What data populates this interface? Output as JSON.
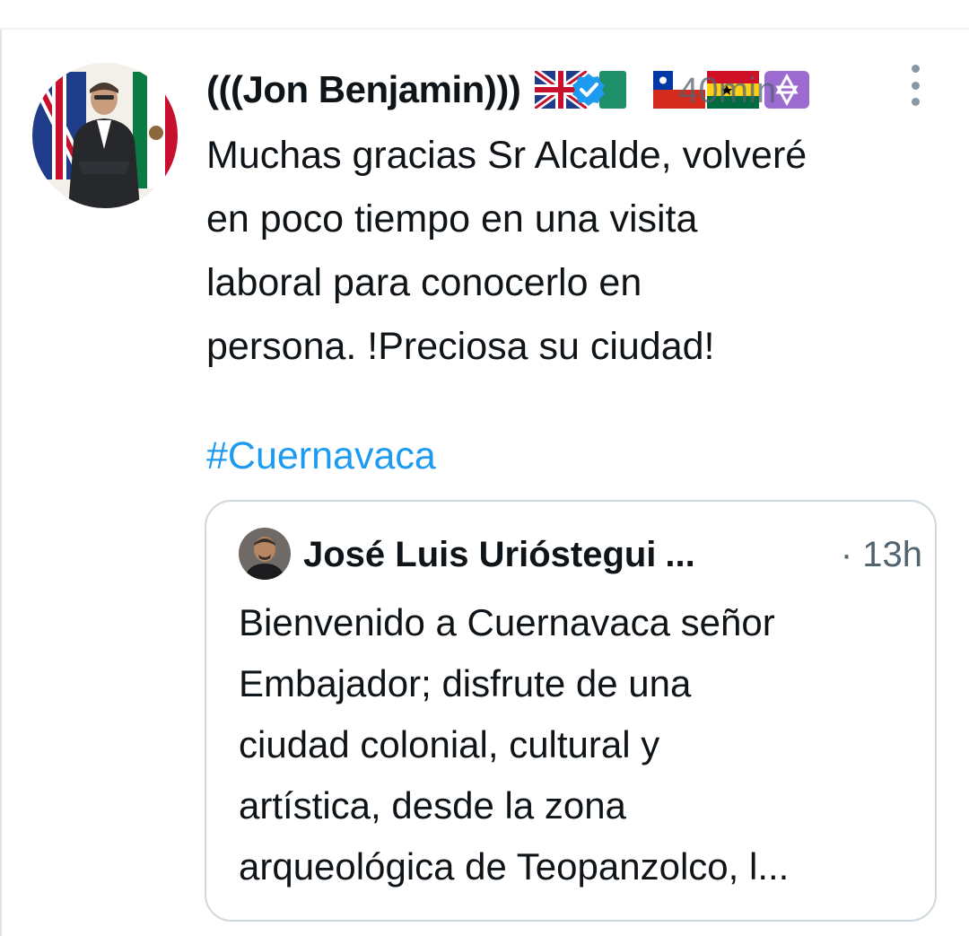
{
  "tweet": {
    "display_name": "(((Jon Benjamin)))",
    "timestamp": "40min",
    "text": "Muchas gracias Sr Alcalde, volveré\nen poco tiempo en una visita\nlaboral para conocerlo en\npersona. !Preciosa su ciudad!",
    "hashtag": "#Cuernavaca",
    "badges": [
      "uk-flag-icon",
      "verified-badge-icon",
      "chile-flag-icon",
      "ghana-bolivia-flag-icon",
      "star-of-david-icon"
    ]
  },
  "quoted_tweet": {
    "display_name": "José Luis Urióstegui",
    "ellipsis": "...",
    "timestamp": "· 13h",
    "text": "Bienvenido a Cuernavaca señor\nEmbajador; disfrute de una\nciudad colonial, cultural y\nartística, desde la zona\narqueológica de Teopanzolco, l..."
  },
  "colors": {
    "link": "#1d9bf0",
    "secondary_text": "#536471",
    "border": "#cfd9de",
    "verified": "#1d9bf0"
  }
}
